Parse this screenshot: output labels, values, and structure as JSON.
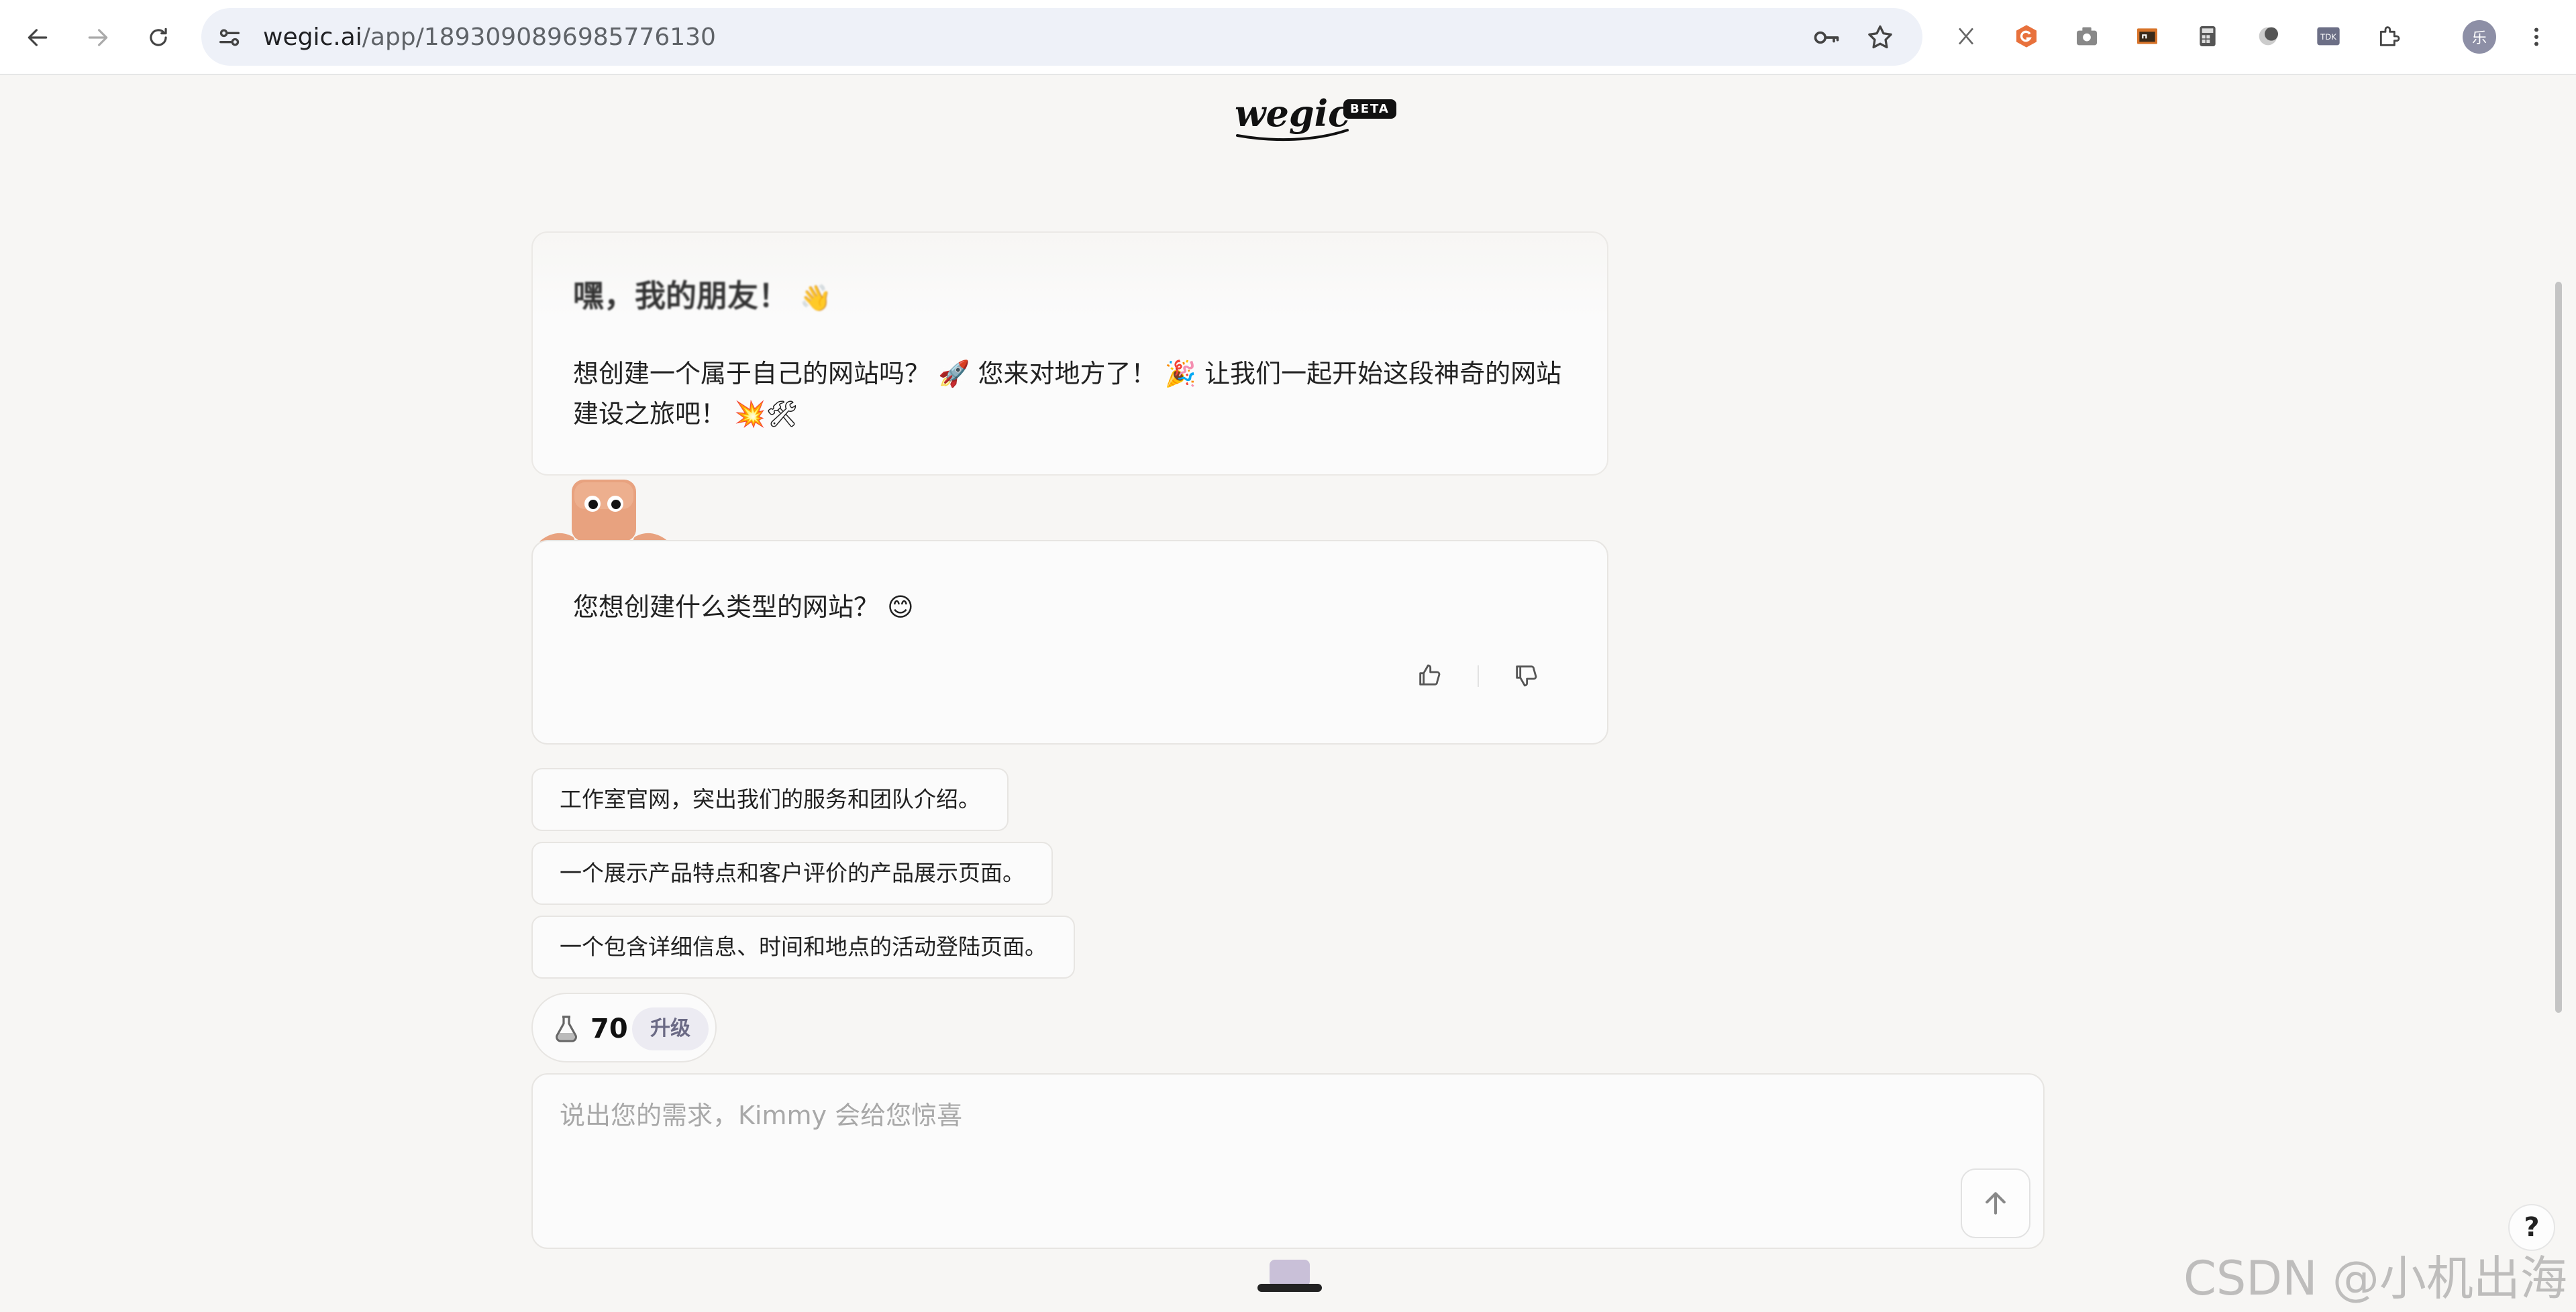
{
  "browser": {
    "url_host": "wegic.ai",
    "url_path": "/app/1893090896985776130",
    "profile_initial": "乐"
  },
  "app": {
    "logo_text": "wegic",
    "beta_label": "BETA"
  },
  "greeting": {
    "title": "嘿，我的朋友！",
    "body_1": "想创建一个属于自己的网站吗？",
    "body_2": "您来对地方了！",
    "body_3": "让我们一起开始这段神奇的网站建设之旅吧！"
  },
  "question": {
    "text": "您想创建什么类型的网站？"
  },
  "suggestions": [
    "工作室官网，突出我们的服务和团队介绍。",
    "一个展示产品特点和客户评价的产品展示页面。",
    "一个包含详细信息、时间和地点的活动登陆页面。"
  ],
  "credits": {
    "count": "70",
    "upgrade_label": "升级"
  },
  "composer": {
    "placeholder": "说出您的需求，Kimmy 会给您惊喜"
  },
  "help": {
    "label": "?"
  },
  "watermark": "CSDN @小机出海",
  "colors": {
    "background": "#f7f6f4",
    "card": "#fbfbfb",
    "border": "#e7e5e2",
    "mascot": "#e8a27f",
    "upgrade_bg": "#ecebf2"
  }
}
